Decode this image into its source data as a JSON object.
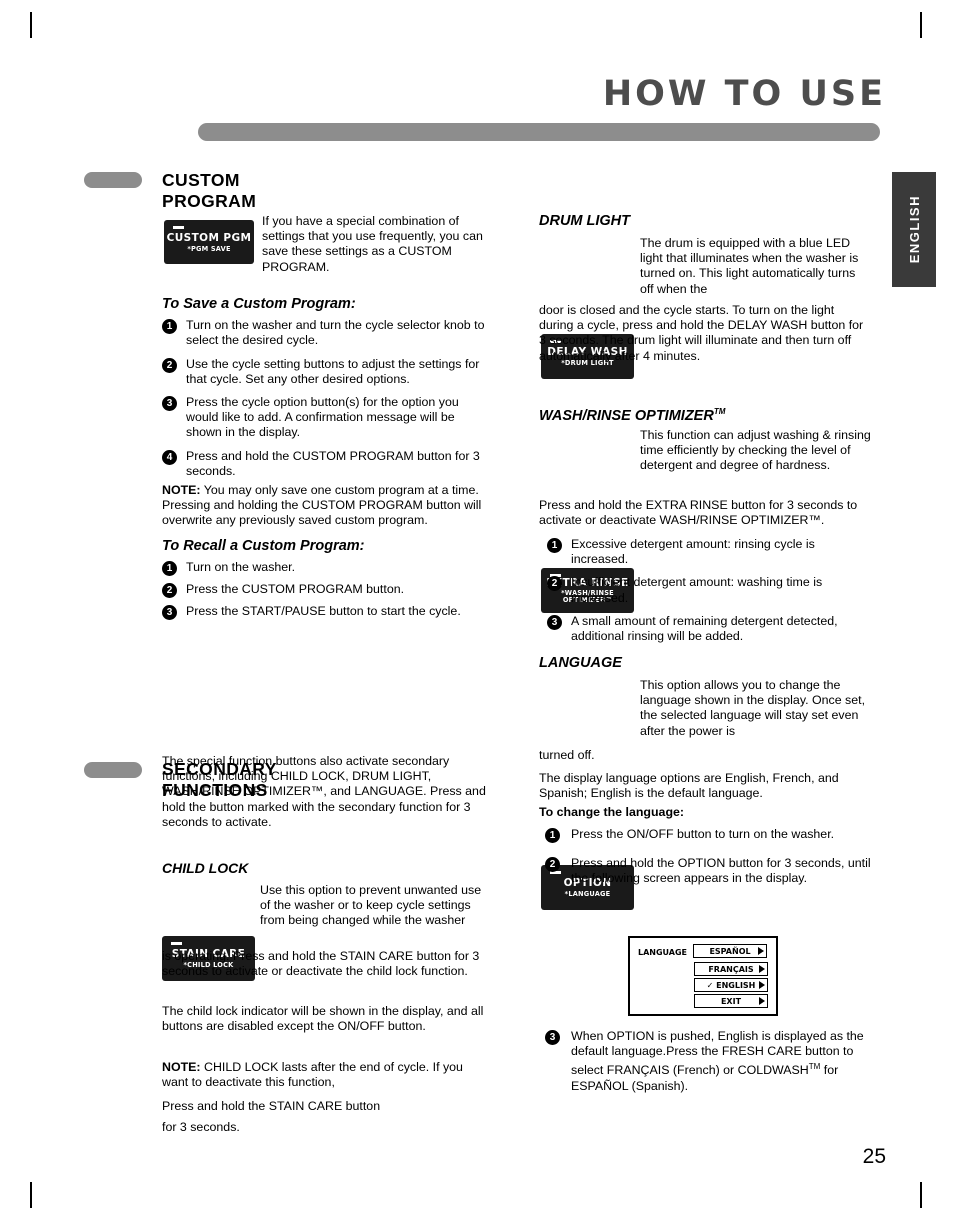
{
  "header": {
    "title": "HOW TO USE",
    "side_tab": "ENGLISH",
    "page_number": "25"
  },
  "sections": {
    "custom_program": {
      "title": "CUSTOM PROGRAM",
      "button": {
        "main": "CUSTOM PGM",
        "sub": "*PGM SAVE"
      },
      "intro": "If you have a special combination of settings that you use frequently, you can save these settings as a CUSTOM PROGRAM.",
      "save_heading": "To Save a Custom Program:",
      "save_steps": [
        "Turn on the washer and turn the cycle selector knob to select the desired cycle.",
        "Use the cycle setting buttons to adjust the settings for that cycle. Set any other desired options.",
        "Press the cycle option button(s) for the option you would like to add. A confirmation message will be shown in the display.",
        "Press and hold the CUSTOM PROGRAM button for 3 seconds."
      ],
      "note_label": "NOTE:",
      "note_text": " You may only save one custom program at a time. Pressing and holding the CUSTOM PROGRAM button will overwrite any previously saved custom program.",
      "recall_heading": "To Recall a Custom Program:",
      "recall_steps": [
        "Turn on the washer.",
        "Press the CUSTOM PROGRAM button.",
        "Press the START/PAUSE button to start the cycle."
      ]
    },
    "secondary_functions": {
      "title": "SECONDARY FUNCTIONS",
      "intro": "The special function buttons also activate secondary functions, including CHILD LOCK, DRUM LIGHT, WASH/RINSE OPTIMIZER™, and LANGUAGE. Press and hold the button marked with the secondary function for 3 seconds to activate.",
      "child_lock": {
        "heading": "CHILD LOCK",
        "button": {
          "main": "STAIN CARE",
          "sub": "*CHILD LOCK"
        },
        "wrap_text": "Use this option to prevent unwanted use of the washer or to keep cycle settings from being changed while the washer",
        "continued": "is operating. Press and hold the STAIN CARE button for 3 seconds to activate or deactivate the child lock function.",
        "para2": "The child lock indicator will be shown in the display, and all buttons are disabled except the ON/OFF button.",
        "note_label": "NOTE:",
        "note_text": " CHILD LOCK lasts after the end of cycle. If you want to deactivate this function,",
        "para3": "Press and hold the STAIN CARE button",
        "para4": "for 3 seconds."
      }
    },
    "drum_light": {
      "heading": "DRUM LIGHT",
      "button": {
        "main": "DELAY WASH",
        "sub": "*DRUM LIGHT"
      },
      "wrap_text": "The drum is equipped with a blue LED light that illuminates when the washer is turned on. This light automatically turns off when the",
      "continued": "door is closed and the cycle starts. To turn on the light during a cycle, press and hold the DELAY WASH button for 3 seconds. The drum light will illuminate and then turn off automatically after 4 minutes."
    },
    "wash_rinse_optimizer": {
      "heading": "WASH/RINSE OPTIMIZER",
      "heading_tm": "TM",
      "button": {
        "main": "EXTRA RINSE",
        "sub1": "*WASH/RINSE",
        "sub2": "OPTIMIZER™"
      },
      "wrap_text": "This function can adjust  washing & rinsing time efficiently  by checking the level of detergent and degree of hardness.",
      "continued": "Press and hold the EXTRA RINSE button for 3 seconds to activate or deactivate WASH/RINSE OPTIMIZER™.",
      "steps": [
        "Excessive detergent amount: rinsing cycle is increased.",
        "Insufficient detergent amount: washing time is increased.",
        "A small amount of remaining detergent detected, additional rinsing will be added."
      ]
    },
    "language": {
      "heading": "LANGUAGE",
      "button": {
        "main": "OPTION",
        "sub": "*LANGUAGE"
      },
      "wrap_text": "This option allows you to change the language shown in the display. Once set, the selected language will stay set even after the power is",
      "continued": "turned off.",
      "para2": "The display language options are English, French, and Spanish; English is the default language.",
      "change_heading": "To change the language:",
      "steps": [
        "Press the ON/OFF button to turn on the washer.",
        "Press and hold the OPTION button for 3 seconds, until the following screen appears in the display."
      ],
      "screen": {
        "label": "LANGUAGE",
        "options": [
          "ESPAÑOL",
          "FRANÇAIS",
          "✓ ENGLISH",
          "EXIT"
        ]
      },
      "step3_parts": {
        "a": "When OPTION is pushed, English is displayed as the default language.Press the FRESH CARE button to select  FRANÇAIS (French) or COLDWASH",
        "tm": "TM",
        "b": " for ESPAÑOL (Spanish)."
      }
    }
  },
  "colors": {
    "bar": "#8d8d8d",
    "heading": "#4d4d4d",
    "button_bg": "#1a1a1a"
  }
}
